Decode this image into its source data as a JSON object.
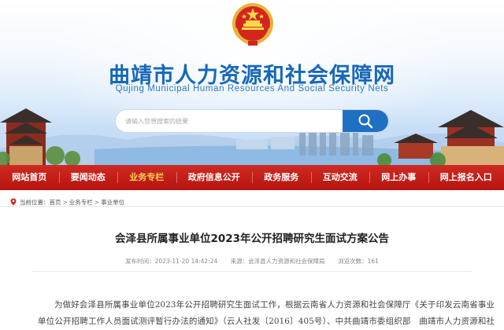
{
  "site": {
    "title": "曲靖市人力资源和社会保障网",
    "subtitle": "Qujing Municipal Human Resources And Social Security Nets"
  },
  "search": {
    "placeholder": "请输入您想搜索的结果"
  },
  "nav": {
    "items": [
      {
        "label": "网站首页"
      },
      {
        "label": "要闻动态"
      },
      {
        "label": "业务专栏"
      },
      {
        "label": "政府信息公开"
      },
      {
        "label": "政务服务"
      },
      {
        "label": "互动交流"
      },
      {
        "label": "网上办事"
      },
      {
        "label": "网上报名入口"
      }
    ],
    "active_index": 2
  },
  "breadcrumb": {
    "prefix": "当前位置：",
    "items": [
      "首页",
      "业务专栏",
      "事业单位"
    ],
    "separator": ">"
  },
  "article": {
    "title": "会泽县所属事业单位2023年公开招聘研究生面试方案公告",
    "date": "发布时间：2023-11-20 14:42:24",
    "source": "来源：会泽县人力资源和社会保障局",
    "views": "浏览次数：161",
    "body": "为做好会泽县所属事业单位2023年公开招聘研究生面试工作，根据云南省人力资源和社会保障厅《关于印发云南省事业单位公开招聘工作人员面试测评暂行办法的通知》（云人社发〔2016〕405号）、中共曲靖市委组织部　曲靖市人力资源和社会保障局"
  },
  "colors": {
    "brand_blue": "#1768b8",
    "nav_red": "#c11e17",
    "nav_active": "#ffd25a",
    "search_button": "#1f6fc2"
  },
  "icons": {
    "emblem": "national-emblem",
    "search": "magnifier-icon",
    "location": "location-pin-icon"
  }
}
